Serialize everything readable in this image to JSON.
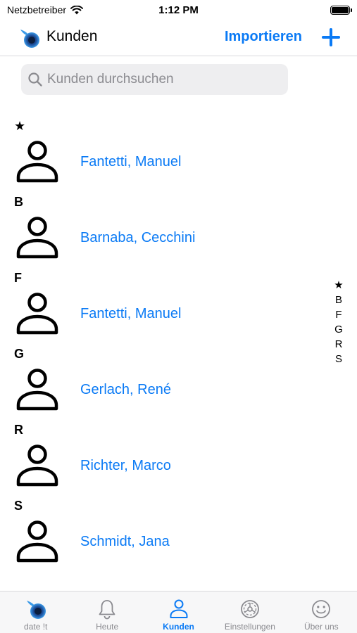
{
  "status_bar": {
    "carrier": "Netzbetreiber",
    "time": "1:12 PM"
  },
  "nav": {
    "title": "Kunden",
    "import_label": "Importieren",
    "add_icon": "plus-icon"
  },
  "search": {
    "placeholder": "Kunden durchsuchen",
    "value": ""
  },
  "sections": [
    {
      "header": "★",
      "customers": [
        "Fantetti, Manuel"
      ]
    },
    {
      "header": "B",
      "customers": [
        "Barnaba, Cecchini"
      ]
    },
    {
      "header": "F",
      "customers": [
        "Fantetti, Manuel"
      ]
    },
    {
      "header": "G",
      "customers": [
        "Gerlach, René"
      ]
    },
    {
      "header": "R",
      "customers": [
        "Richter, Marco"
      ]
    },
    {
      "header": "S",
      "customers": [
        "Schmidt, Jana"
      ]
    }
  ],
  "index_bar": [
    "★",
    "B",
    "F",
    "G",
    "R",
    "S"
  ],
  "tabs": [
    {
      "label": "date !t",
      "icon": "app-logo-icon",
      "active": false
    },
    {
      "label": "Heute",
      "icon": "bell-icon",
      "active": false
    },
    {
      "label": "Kunden",
      "icon": "person-icon",
      "active": true
    },
    {
      "label": "Einstellungen",
      "icon": "gear-icon",
      "active": false
    },
    {
      "label": "Über uns",
      "icon": "smiley-icon",
      "active": false
    }
  ],
  "colors": {
    "accent": "#0a7af5",
    "inactive": "#8a8a8f"
  }
}
